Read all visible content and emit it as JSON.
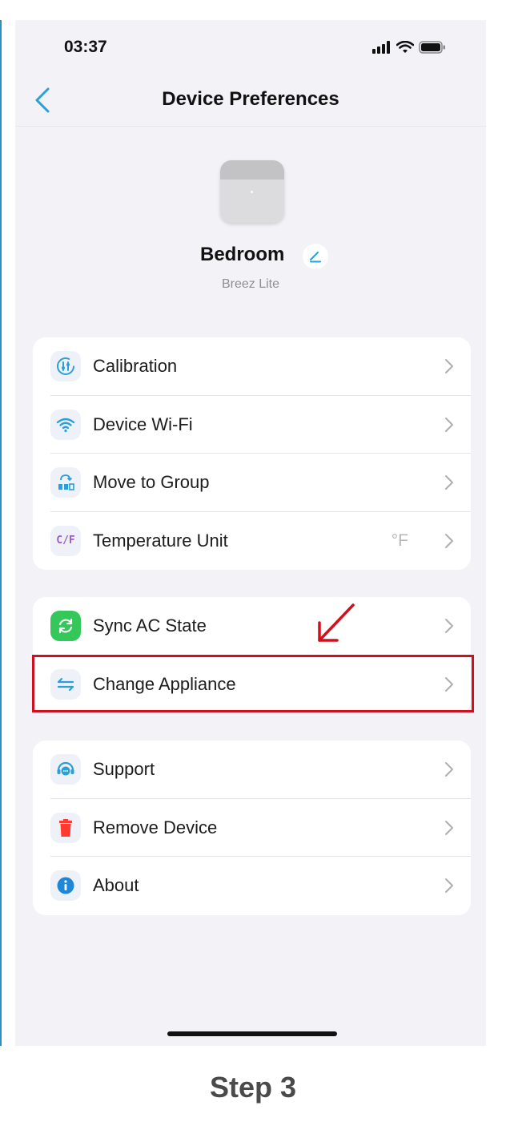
{
  "status_bar": {
    "time": "03:37"
  },
  "nav": {
    "title": "Device Preferences"
  },
  "device": {
    "name": "Bedroom",
    "model": "Breez Lite"
  },
  "section1": {
    "items": [
      {
        "label": "Calibration",
        "icon": "calibration-icon"
      },
      {
        "label": "Device Wi-Fi",
        "icon": "wifi-icon"
      },
      {
        "label": "Move to Group",
        "icon": "group-icon"
      },
      {
        "label": "Temperature Unit",
        "icon": "temperature-unit-icon",
        "value": "°F",
        "icon_text": "C/F"
      }
    ]
  },
  "section2": {
    "items": [
      {
        "label": "Sync AC State",
        "icon": "sync-icon"
      },
      {
        "label": "Change Appliance",
        "icon": "swap-arrows-icon"
      }
    ]
  },
  "section3": {
    "items": [
      {
        "label": "Support",
        "icon": "support-icon"
      },
      {
        "label": "Remove Device",
        "icon": "trash-icon"
      },
      {
        "label": "About",
        "icon": "info-icon"
      }
    ]
  },
  "caption": "Step 3",
  "colors": {
    "accent": "#2a9fd8",
    "highlight": "#d0101e",
    "sync_green": "#34c759",
    "danger": "#ff3b30",
    "purple": "#9b59d0"
  }
}
